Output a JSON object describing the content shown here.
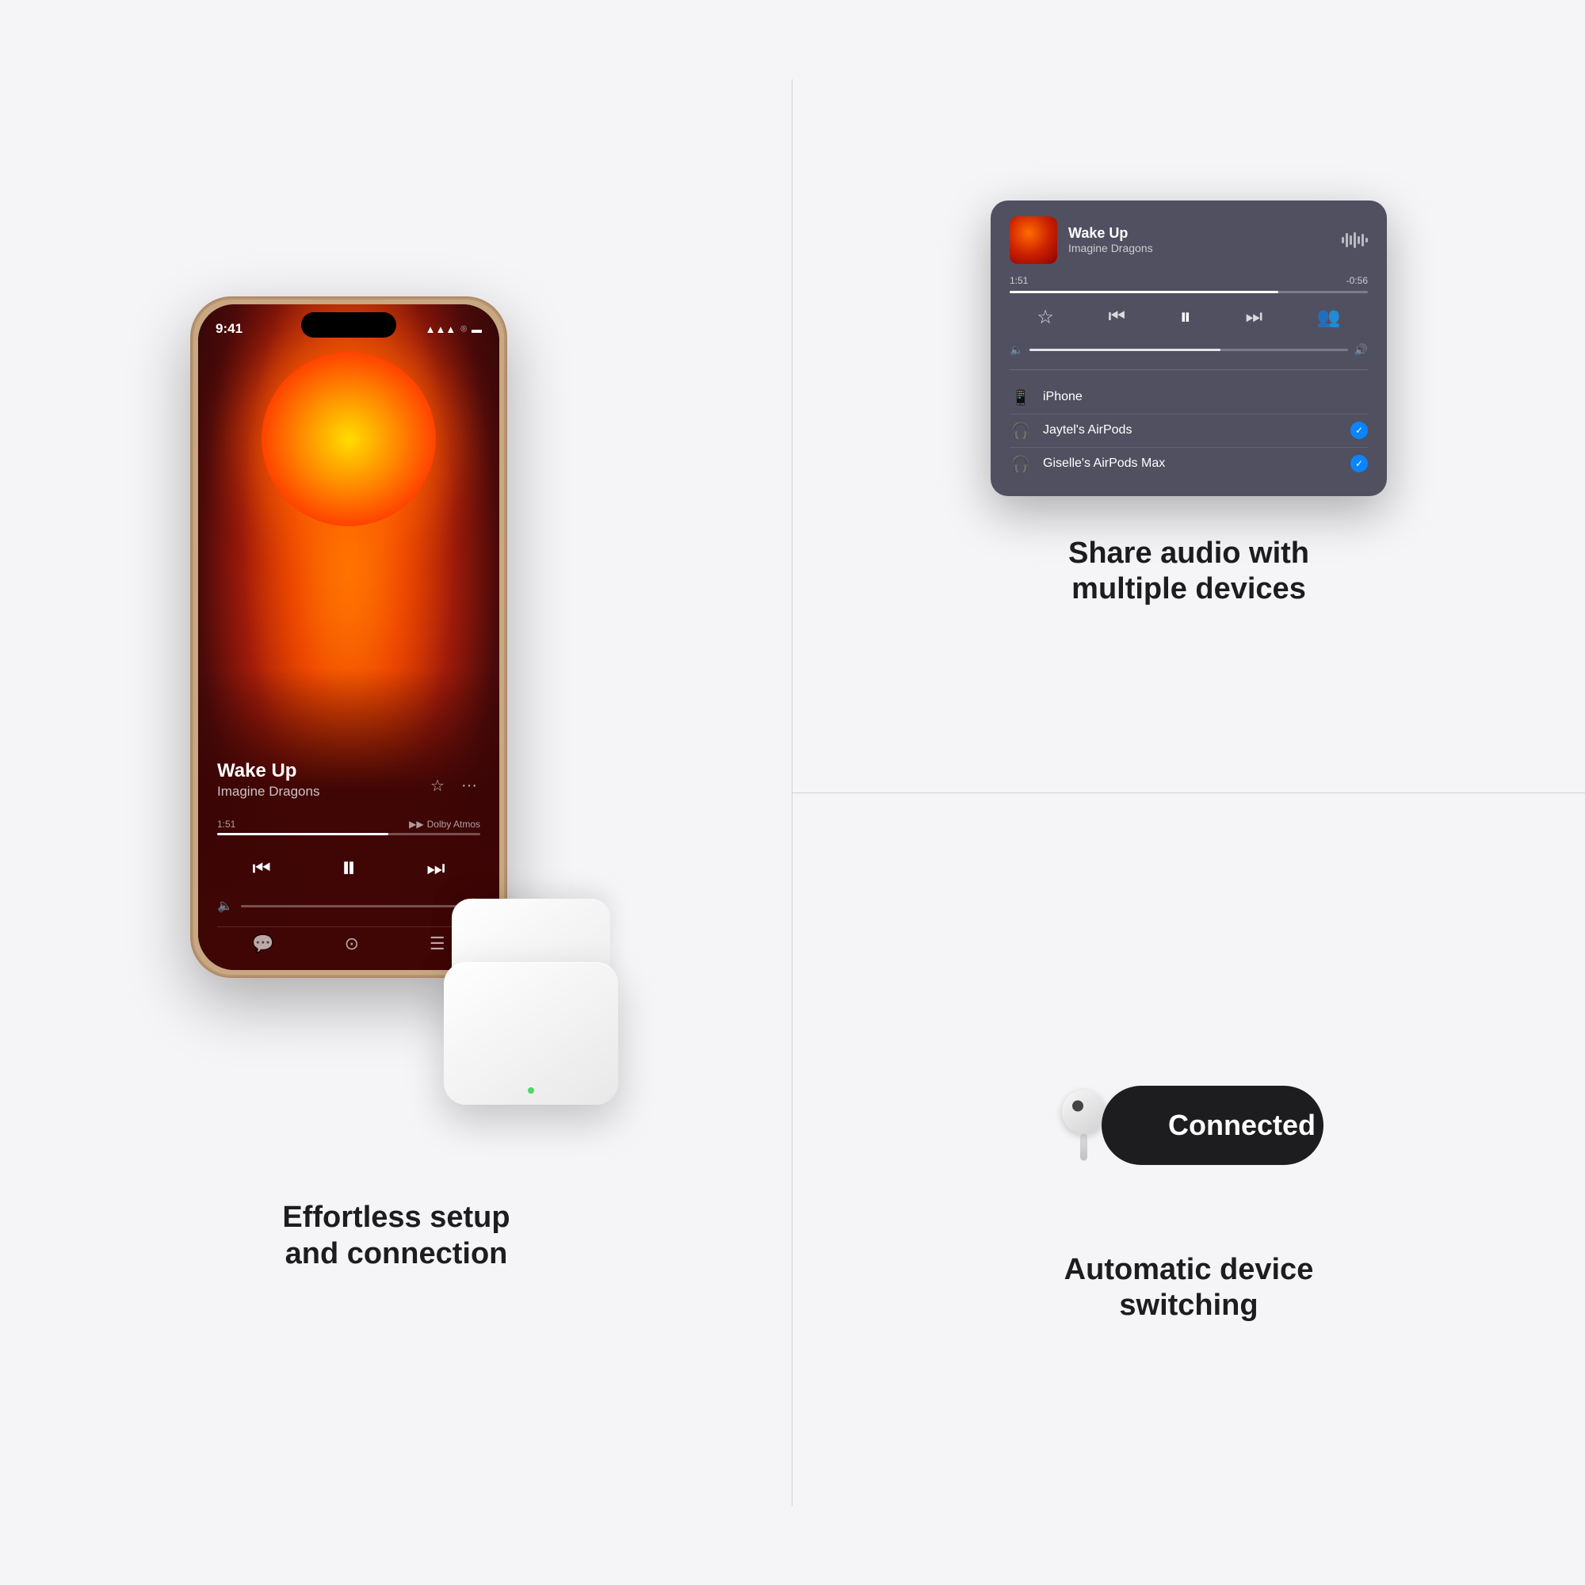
{
  "left": {
    "phone": {
      "time": "9:41",
      "signal": "▲▲▲",
      "song_title": "Wake Up",
      "song_artist": "Imagine Dragons",
      "time_current": "1:51",
      "dolby": "Dolby Atmos"
    },
    "caption": "Effortless setup\nand connection"
  },
  "right": {
    "top": {
      "widget": {
        "song_title": "Wake Up",
        "song_artist": "Imagine Dragons",
        "time_current": "1:51",
        "time_remaining": "-0:56",
        "devices": [
          {
            "name": "iPhone",
            "icon": "📱",
            "checked": false
          },
          {
            "name": "Jaytel's AirPods",
            "icon": "🎧",
            "checked": true
          },
          {
            "name": "Giselle's AirPods Max",
            "icon": "🎧",
            "checked": true
          }
        ]
      },
      "caption": "Share audio with\nmultiple devices"
    },
    "bottom": {
      "connected_label": "Connected",
      "caption": "Automatic device\nswitching"
    }
  }
}
